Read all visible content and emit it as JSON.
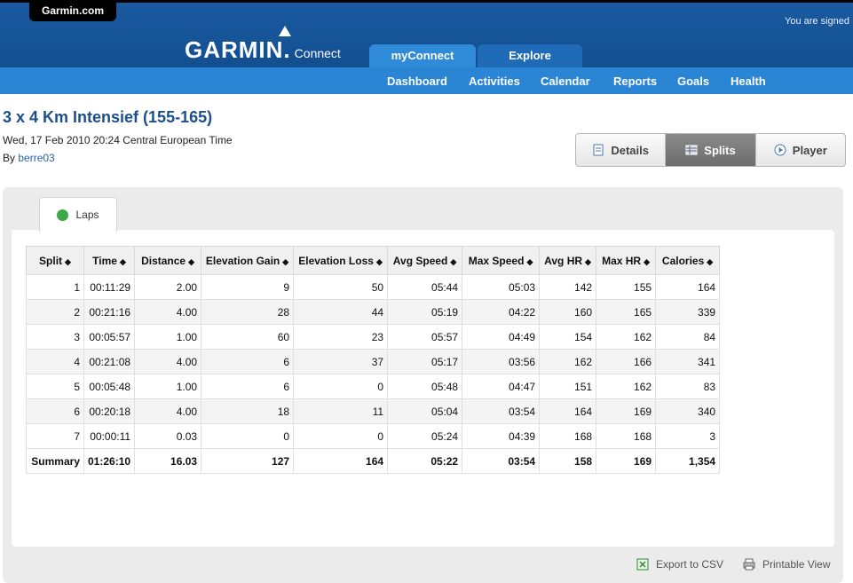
{
  "header": {
    "garmin_tab": "Garmin.com",
    "signed_text": "You are signed",
    "logo_main": "GARMIN.",
    "logo_sub": "Connect",
    "tabs": [
      "myConnect",
      "Explore"
    ],
    "nav": [
      "Dashboard",
      "Activities",
      "Calendar",
      "Reports",
      "Goals",
      "Health"
    ]
  },
  "activity": {
    "title": "3 x 4 Km Intensief (155-165)",
    "datetime": "Wed, 17 Feb 2010 20:24 Central European Time",
    "by_label": "By",
    "author": "berre03"
  },
  "views": [
    "Details",
    "Splits",
    "Player"
  ],
  "laps_tab": "Laps",
  "table": {
    "headers": [
      "Split",
      "Time",
      "Distance",
      "Elevation Gain",
      "Elevation Loss",
      "Avg Speed",
      "Max Speed",
      "Avg HR",
      "Max HR",
      "Calories"
    ],
    "rows": [
      [
        "1",
        "00:11:29",
        "2.00",
        "9",
        "50",
        "05:44",
        "05:03",
        "142",
        "155",
        "164"
      ],
      [
        "2",
        "00:21:16",
        "4.00",
        "28",
        "44",
        "05:19",
        "04:22",
        "160",
        "165",
        "339"
      ],
      [
        "3",
        "00:05:57",
        "1.00",
        "60",
        "23",
        "05:57",
        "04:49",
        "154",
        "162",
        "84"
      ],
      [
        "4",
        "00:21:08",
        "4.00",
        "6",
        "37",
        "05:17",
        "03:56",
        "162",
        "166",
        "341"
      ],
      [
        "5",
        "00:05:48",
        "1.00",
        "6",
        "0",
        "05:48",
        "04:47",
        "151",
        "162",
        "83"
      ],
      [
        "6",
        "00:20:18",
        "4.00",
        "18",
        "11",
        "05:04",
        "03:54",
        "164",
        "169",
        "340"
      ],
      [
        "7",
        "00:00:11",
        "0.03",
        "0",
        "0",
        "05:24",
        "04:39",
        "168",
        "168",
        "3"
      ]
    ],
    "summary": [
      "Summary",
      "01:26:10",
      "16.03",
      "127",
      "164",
      "05:22",
      "03:54",
      "158",
      "169",
      "1,354"
    ]
  },
  "footer": {
    "export": "Export to CSV",
    "print": "Printable View"
  },
  "colors": {
    "header_blue": "#1a5aa0",
    "nav_blue": "#2a86d4",
    "title_blue": "#1d4f8c"
  }
}
